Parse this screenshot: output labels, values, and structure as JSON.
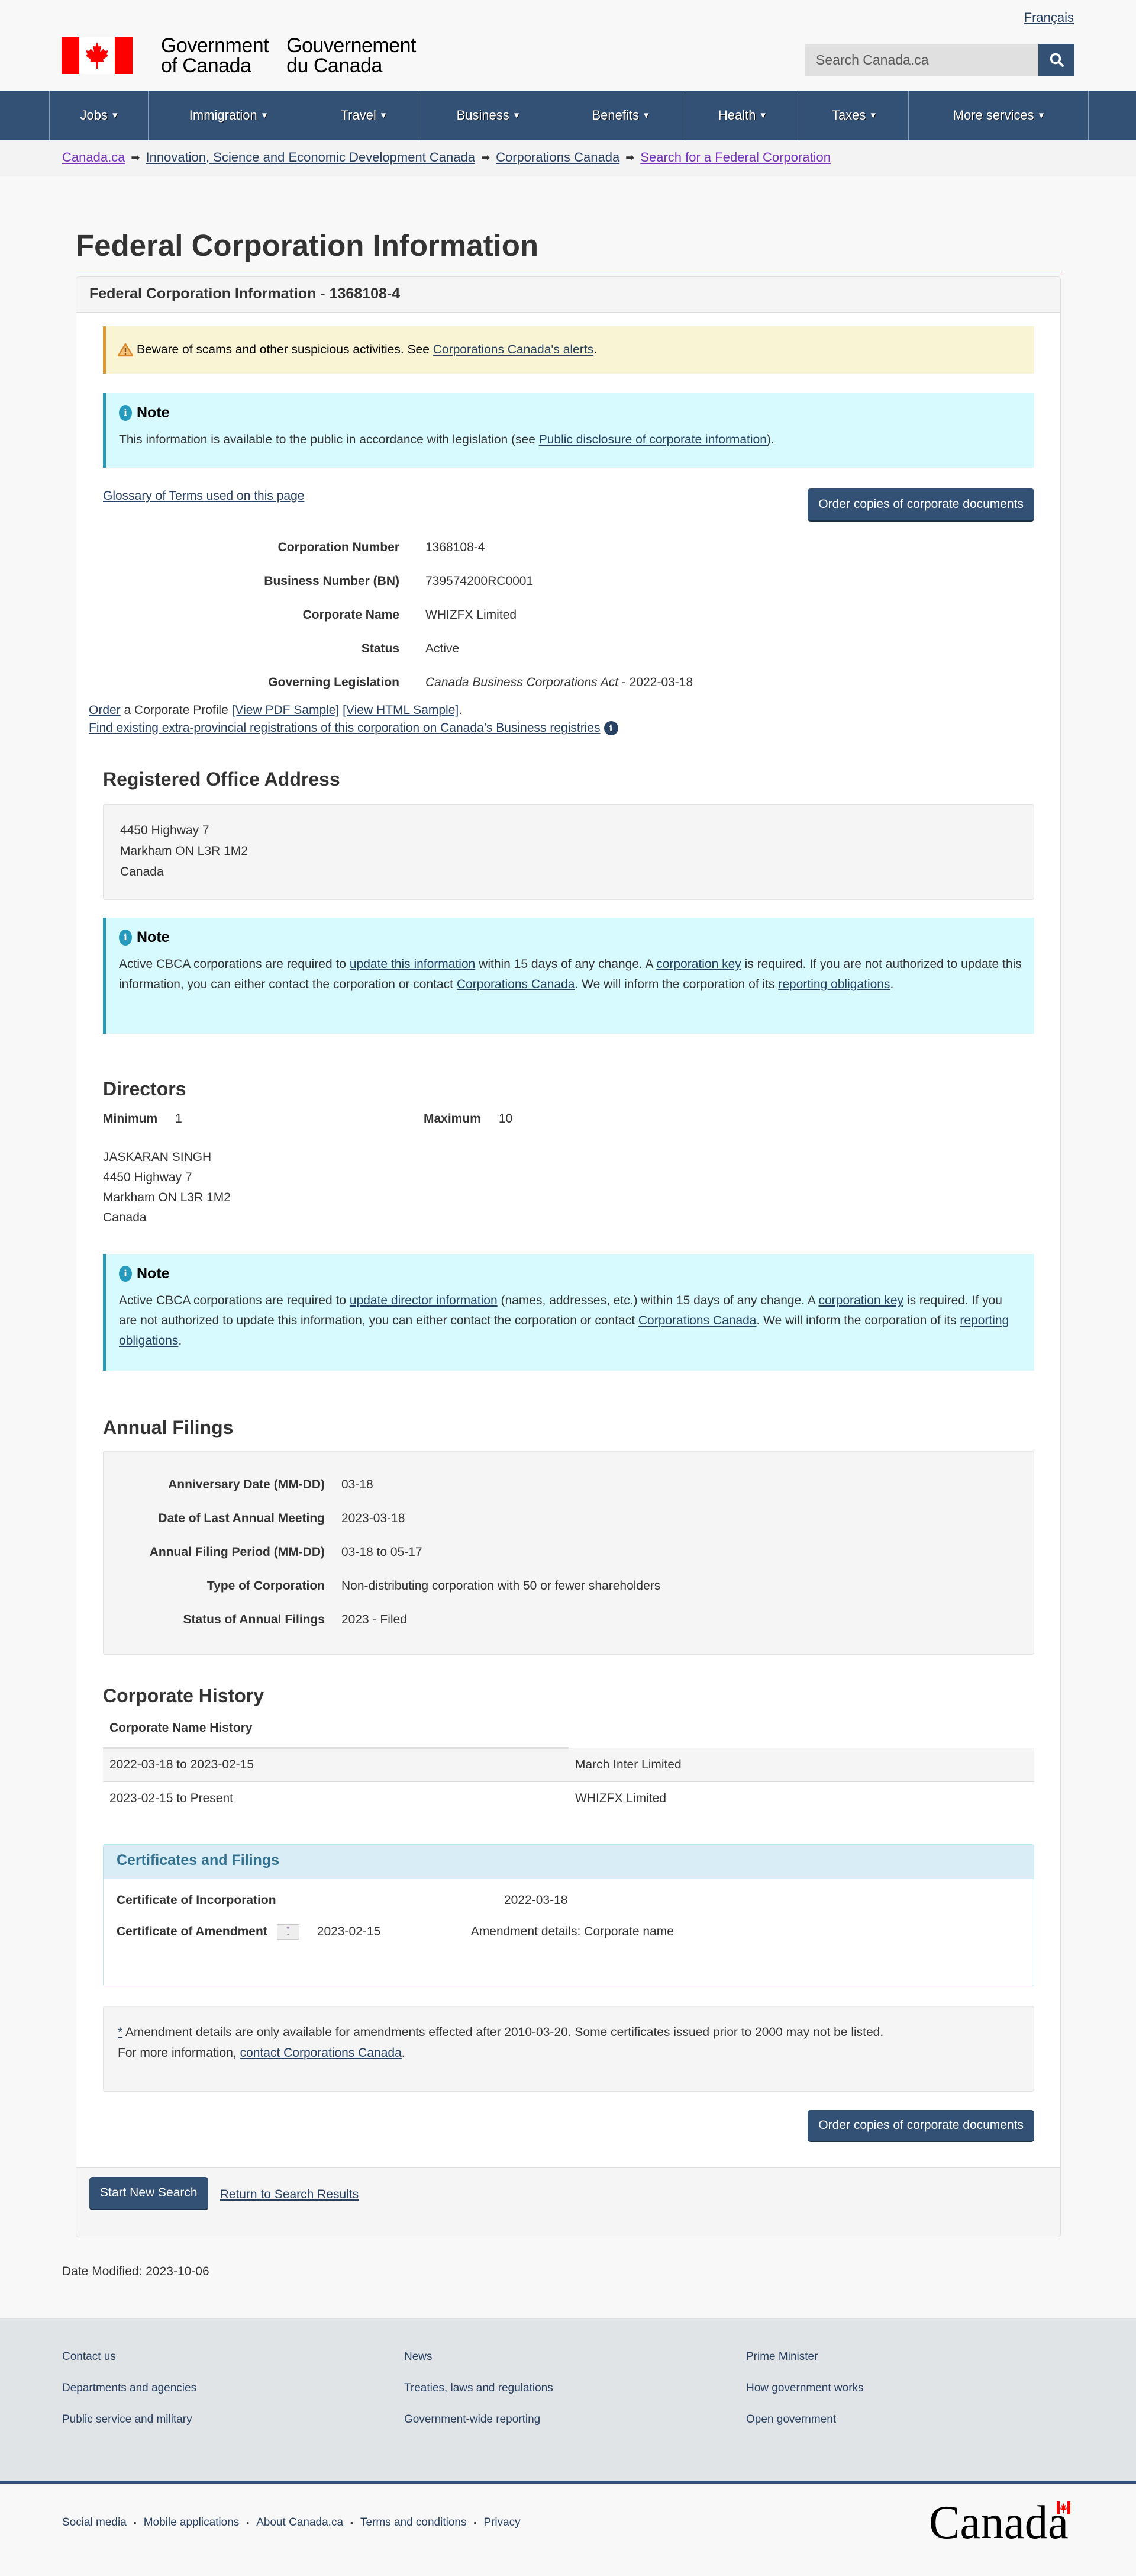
{
  "header": {
    "language_toggle": "Français",
    "brand_en_line1": "Government",
    "brand_en_line2": "of Canada",
    "brand_fr_line1": "Gouvernement",
    "brand_fr_line2": "du Canada",
    "search_placeholder": "Search Canada.ca",
    "search_icon": "magnifier-icon"
  },
  "nav": {
    "items": [
      {
        "label": "Jobs"
      },
      {
        "label": "Immigration"
      },
      {
        "label": "Travel"
      },
      {
        "label": "Business"
      },
      {
        "label": "Benefits"
      },
      {
        "label": "Health"
      },
      {
        "label": "Taxes"
      },
      {
        "label": "More services"
      }
    ],
    "chevron": "▾"
  },
  "breadcrumb": [
    {
      "label": "Canada.ca",
      "visited": true
    },
    {
      "label": "Innovation, Science and Economic Development Canada",
      "visited": false
    },
    {
      "label": "Corporations Canada",
      "visited": false
    },
    {
      "label": "Search for a Federal Corporation",
      "visited": true
    }
  ],
  "page": {
    "title": "Federal Corporation Information",
    "panel_title": "Federal Corporation Information - 1368108-4"
  },
  "warning": {
    "text": "Beware of scams and other suspicious activities. See ",
    "link": "Corporations Canada's alerts",
    "suffix": "."
  },
  "note_public": {
    "title": "Note",
    "text": "This information is available to the public in accordance with legislation (see ",
    "link": "Public disclosure of corporate information",
    "suffix": ")."
  },
  "glossary_link": "Glossary of Terms used on this page",
  "order_button": "Order copies of corporate documents",
  "corporation": {
    "fields": [
      {
        "label": "Corporation Number",
        "value": "1368108-4"
      },
      {
        "label": "Business Number (BN)",
        "value": "739574200RC0001"
      },
      {
        "label": "Corporate Name",
        "value": "WHIZFX Limited"
      },
      {
        "label": "Status",
        "value": "Active"
      }
    ],
    "governing_label": "Governing Legislation",
    "governing_act": "Canada Business Corporations Act",
    "governing_date": " - 2022-03-18"
  },
  "profile": {
    "order_link": "Order",
    "order_text": " a Corporate Profile ",
    "pdf_link": "[View PDF Sample]",
    "html_link": "[View HTML Sample]",
    "suffix": ".",
    "registries_link": "Find existing extra-provincial registrations of this corporation on Canada’s Business registries"
  },
  "registered_office": {
    "heading": "Registered Office Address",
    "lines": [
      "4450 Highway 7",
      "Markham ON L3R 1M2",
      "Canada"
    ]
  },
  "note_office": {
    "title": "Note",
    "t1": "Active CBCA corporations are required to ",
    "l1": "update this information",
    "t2": " within 15 days of any change. A ",
    "l2": "corporation key",
    "t3": " is required. If you are not authorized to update this information, you can either contact the corporation or contact ",
    "l3": "Corporations Canada",
    "t4": ". We will inform the corporation of its ",
    "l4": "reporting obligations",
    "t5": "."
  },
  "directors": {
    "heading": "Directors",
    "min_label": "Minimum",
    "min_value": "1",
    "max_label": "Maximum",
    "max_value": "10",
    "list": [
      {
        "lines": [
          "JASKARAN SINGH",
          "4450 Highway 7",
          "Markham ON L3R 1M2",
          "Canada"
        ]
      }
    ]
  },
  "note_directors": {
    "title": "Note",
    "t1": "Active CBCA corporations are required to ",
    "l1": "update director information",
    "t2": " (names, addresses, etc.) within 15 days of any change. A ",
    "l2": "corporation key",
    "t3": " is required. If you are not authorized to update this information, you can either contact the corporation or contact ",
    "l3": "Corporations Canada",
    "t4": ". We will inform the corporation of its ",
    "l4": "reporting obligations",
    "t5": "."
  },
  "annual_filings": {
    "heading": "Annual Filings",
    "fields": [
      {
        "label": "Anniversary Date (MM-DD)",
        "value": "03-18"
      },
      {
        "label": "Date of Last Annual Meeting",
        "value": "2023-03-18"
      },
      {
        "label": "Annual Filing Period (MM-DD)",
        "value": "03-18 to 05-17"
      },
      {
        "label": "Type of Corporation",
        "value": "Non-distributing corporation with 50 or fewer shareholders"
      },
      {
        "label": "Status of Annual Filings",
        "value": "2023 - Filed"
      }
    ]
  },
  "history": {
    "heading": "Corporate History",
    "table_header": "Corporate Name History",
    "rows": [
      {
        "period": "2022-03-18 to 2023-02-15",
        "name": "March Inter Limited"
      },
      {
        "period": "2023-02-15 to Present",
        "name": "WHIZFX Limited"
      }
    ]
  },
  "certificates": {
    "heading": "Certificates and Filings",
    "incorporation_label": "Certificate of Incorporation",
    "incorporation_date": "2022-03-18",
    "amendment_label": "Certificate of Amendment",
    "amendment_toggle_star": "*",
    "amendment_toggle_dash": "-",
    "amendment_date": "2023-02-15",
    "amendment_details": "Amendment details: Corporate name"
  },
  "footnote": {
    "star": "*",
    "text": " Amendment details are only available for amendments effected after 2010-03-20. Some certificates issued prior to 2000 may not be listed.",
    "more_text": "For more information, ",
    "link": "contact Corporations Canada",
    "suffix": "."
  },
  "actions": {
    "start_new_search": "Start New Search",
    "return_results": "Return to Search Results"
  },
  "date_modified": "Date Modified: 2023-10-06",
  "footer": {
    "columns": [
      [
        "Contact us",
        "Departments and agencies",
        "Public service and military"
      ],
      [
        "News",
        "Treaties, laws and regulations",
        "Government-wide reporting"
      ],
      [
        "Prime Minister",
        "How government works",
        "Open government"
      ]
    ],
    "sub_links": [
      "Social media",
      "Mobile applications",
      "About Canada.ca",
      "Terms and conditions",
      "Privacy"
    ],
    "wordmark": "Canada"
  },
  "colors": {
    "nav_bg": "#335075",
    "link": "#284162",
    "visited_link": "#7834bc",
    "title_rule": "#af3c43",
    "note_bg": "#d7faff",
    "note_border": "#269abc",
    "warning_bg": "#f9f4d4",
    "warning_border": "#e6992e",
    "flag_red": "#ff0000"
  }
}
